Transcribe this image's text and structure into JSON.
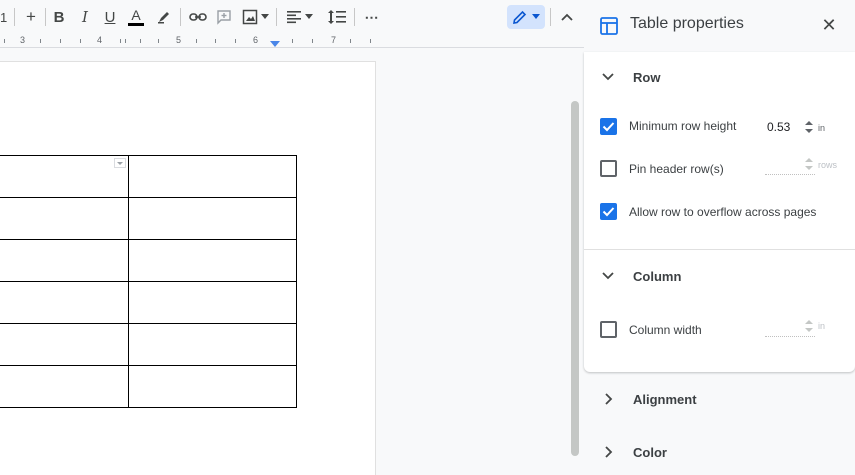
{
  "toolbar": {
    "font_size": "1",
    "plus": "+",
    "bold": "B",
    "italic": "I",
    "underline": "U",
    "text_color": "A",
    "more": "⋯"
  },
  "ruler": {
    "numbers": [
      "3",
      "4",
      "5",
      "6",
      "7"
    ]
  },
  "table": {
    "rows": 6,
    "cols": 2
  },
  "panel": {
    "title": "Table properties",
    "close": "✕",
    "row": {
      "label": "Row",
      "min_height_label": "Minimum row height",
      "min_height_checked": true,
      "min_height_value": "0.53",
      "min_height_unit": "in",
      "pin_header_label": "Pin header row(s)",
      "pin_header_checked": false,
      "pin_header_unit": "rows",
      "overflow_label": "Allow row to overflow across pages",
      "overflow_checked": true
    },
    "column": {
      "label": "Column",
      "width_label": "Column width",
      "width_checked": false,
      "width_unit": "in"
    },
    "alignment": {
      "label": "Alignment"
    },
    "color": {
      "label": "Color"
    }
  },
  "colors": {
    "accent": "#1a73e8",
    "edit_mode_bg": "#d3e3fd"
  }
}
